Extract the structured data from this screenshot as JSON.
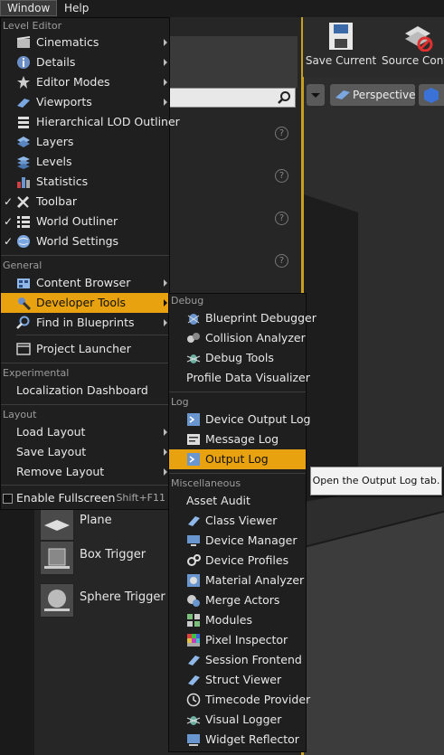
{
  "menubar": {
    "window": "Window",
    "help": "Help"
  },
  "toolbar": {
    "save_current": "Save Current",
    "source_control": "Source Contr"
  },
  "viewport": {
    "perspective": "Perspective"
  },
  "place_items": [
    {
      "label": "Plane",
      "icon": "plane-icon"
    },
    {
      "label": "Box Trigger",
      "icon": "box-trigger-icon"
    },
    {
      "label": "Sphere Trigger",
      "icon": "sphere-trigger-icon"
    }
  ],
  "window_menu": {
    "sections": {
      "level_editor": "Level Editor",
      "general": "General",
      "experimental": "Experimental",
      "layout": "Layout"
    },
    "items": {
      "cinematics": "Cinematics",
      "details": "Details",
      "editor_modes": "Editor Modes",
      "viewports": "Viewports",
      "hlod_outliner": "Hierarchical LOD Outliner",
      "layers": "Layers",
      "levels": "Levels",
      "statistics": "Statistics",
      "toolbar": "Toolbar",
      "world_outliner": "World Outliner",
      "world_settings": "World Settings",
      "content_browser": "Content Browser",
      "developer_tools": "Developer Tools",
      "find_in_blueprints": "Find in Blueprints",
      "project_launcher": "Project Launcher",
      "localization_dashboard": "Localization Dashboard",
      "load_layout": "Load Layout",
      "save_layout": "Save Layout",
      "remove_layout": "Remove Layout",
      "enable_fullscreen": "Enable Fullscreen",
      "fullscreen_shortcut": "Shift+F11",
      "checkmark": "✓"
    }
  },
  "dev_tools_menu": {
    "sections": {
      "debug": "Debug",
      "log": "Log",
      "misc": "Miscellaneous"
    },
    "items": {
      "blueprint_debugger": "Blueprint Debugger",
      "collision_analyzer": "Collision Analyzer",
      "debug_tools": "Debug Tools",
      "profile_data_visualizer": "Profile Data Visualizer",
      "device_output_log": "Device Output Log",
      "message_log": "Message Log",
      "output_log": "Output Log",
      "asset_audit": "Asset Audit",
      "class_viewer": "Class Viewer",
      "device_manager": "Device Manager",
      "device_profiles": "Device Profiles",
      "material_analyzer": "Material Analyzer",
      "merge_actors": "Merge Actors",
      "modules": "Modules",
      "pixel_inspector": "Pixel Inspector",
      "session_frontend": "Session Frontend",
      "struct_viewer": "Struct Viewer",
      "timecode_provider": "Timecode Provider",
      "visual_logger": "Visual Logger",
      "widget_reflector": "Widget Reflector"
    }
  },
  "tooltip": {
    "text": "Open the Output Log tab."
  },
  "help_marker": "?",
  "colors": {
    "highlight": "#e8a20f",
    "menu_bg": "#1f1f1f",
    "accent_border": "#c8a020"
  }
}
